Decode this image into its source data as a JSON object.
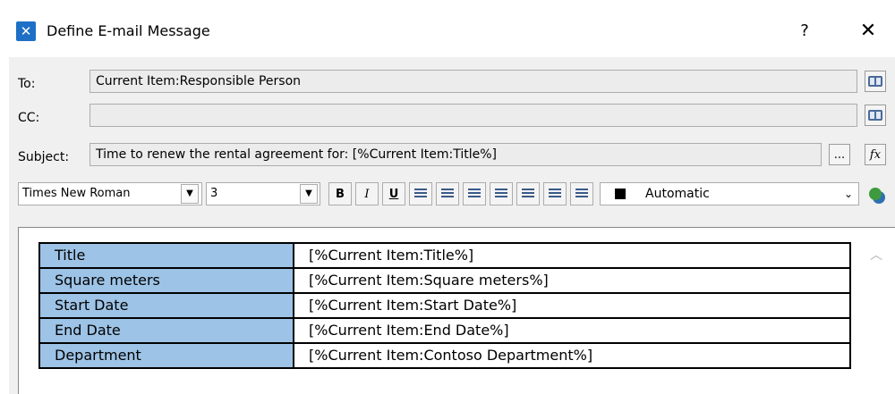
{
  "window": {
    "title": "Define E-mail Message",
    "help": "?",
    "close": "✕"
  },
  "form": {
    "to_label": "To:",
    "to_value": "Current Item:Responsible Person",
    "cc_label": "CC:",
    "cc_value": "",
    "subject_label": "Subject:",
    "subject_value": "Time to renew the rental agreement for: [%Current Item:Title%]",
    "ellipsis": "...",
    "fx": "fx"
  },
  "toolbar": {
    "font": "Times New Roman",
    "size": "3",
    "bold": "B",
    "italic": "I",
    "underline": "U",
    "color_label": "Automatic"
  },
  "icons": [
    "address-book-icon",
    "formula-icon",
    "chevron-down-icon",
    "align-left-icon",
    "align-center-icon",
    "align-right-icon",
    "numbered-list-icon",
    "bullet-list-icon",
    "outdent-icon",
    "indent-icon",
    "link-icon"
  ],
  "colors": {
    "accent": "#1e6fc6",
    "table_header": "#9dc3e6"
  },
  "body_table": {
    "rows": [
      {
        "key": "Title",
        "value": "[%Current Item:Title%]"
      },
      {
        "key": "Square meters",
        "value": "[%Current Item:Square meters%]"
      },
      {
        "key": "Start Date",
        "value": "[%Current Item:Start Date%]"
      },
      {
        "key": "End Date",
        "value": "[%Current Item:End Date%]"
      },
      {
        "key": "Department",
        "value": "[%Current Item:Contoso Department%]"
      }
    ]
  }
}
